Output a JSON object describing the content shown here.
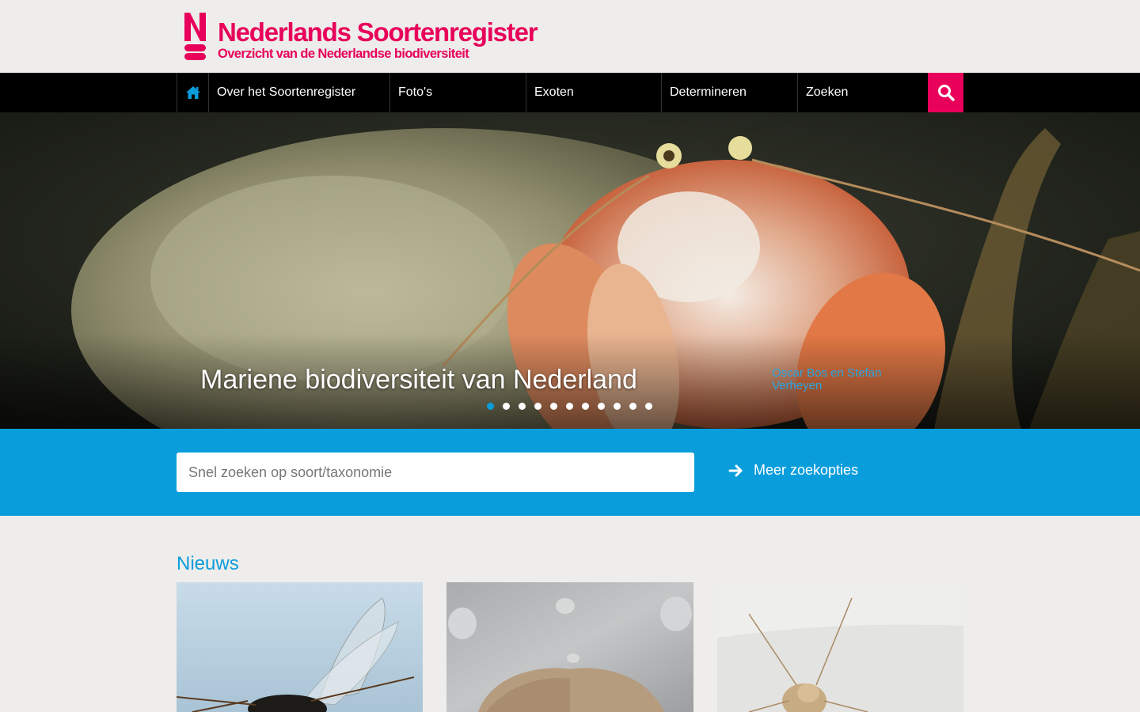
{
  "header": {
    "title": "Nederlands Soortenregister",
    "subtitle": "Overzicht van de Nederlandse biodiversiteit",
    "brand_color": "#e8005a"
  },
  "nav": {
    "home_icon": "home-icon",
    "items": [
      {
        "label": "Over het Soortenregister"
      },
      {
        "label": "Foto's"
      },
      {
        "label": "Exoten"
      },
      {
        "label": "Determineren"
      },
      {
        "label": "Zoeken"
      }
    ],
    "search_icon": "search-icon"
  },
  "hero": {
    "title": "Mariene biodiversiteit van Nederland",
    "credit": "Oscar Bos en Stefan Verheyen",
    "slides_total": 11,
    "active_slide": 1
  },
  "search": {
    "placeholder": "Snel zoeken op soort/taxonomie",
    "more_label": "Meer zoekopties",
    "accent_color": "#0a9ddc"
  },
  "news": {
    "heading": "Nieuws",
    "cards": [
      {
        "image": "wasp-photo"
      },
      {
        "image": "moth-photo"
      },
      {
        "image": "insect-photo"
      }
    ]
  }
}
